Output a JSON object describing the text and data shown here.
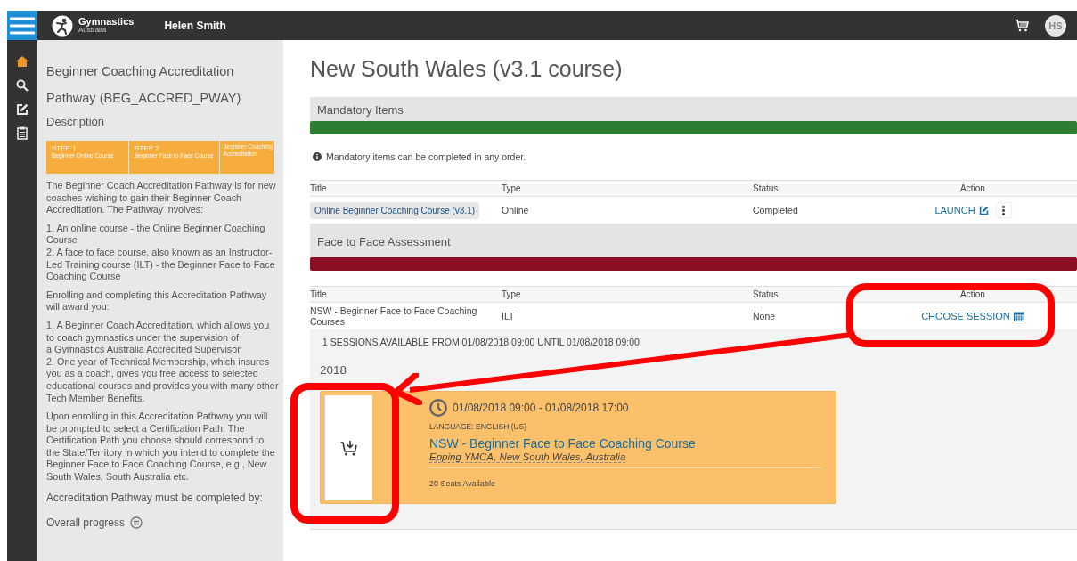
{
  "top_bar": {
    "org_name": "Gymnastics",
    "org_sub": "Australia",
    "user_name": "Helen Smith",
    "avatar_initials": "HS"
  },
  "nav": [
    {
      "kind": "home",
      "selected": true
    },
    {
      "kind": "search",
      "selected": false
    },
    {
      "kind": "edit",
      "selected": false
    },
    {
      "kind": "clipboard",
      "selected": false
    }
  ],
  "panel": {
    "title": "Beginner Coaching Accreditation Pathway (BEG_ACCRED_PWAY)",
    "description_label": "Description",
    "steps": [
      {
        "kind": "step",
        "title": "STEP 1",
        "subtitle": "Beginner Online Course"
      },
      {
        "kind": "step",
        "title": "STEP 2",
        "subtitle": "Beginner Face to Face Course"
      },
      {
        "kind": "final",
        "label": "Beginner Coaching Accreditation"
      }
    ],
    "paragraphs": [
      "The Beginner Coach Accreditation Pathway is for new coaches wishing to gain their Beginner Coach Accreditation. The Pathway involves:",
      "1. An online course - the Online Beginner Coaching Course\n2. A face to face course, also known as an Instructor-Led Training course (ILT) - the Beginner Face to Face Coaching Course",
      "Enrolling and completing this Accreditation Pathway will award you:",
      "1. A Beginner Coach Accreditation, which allows you to coach gymnastics under the supervision of\na Gymnastics Australia Accredited Supervisor\n2. One year of Technical Membership, which insures you as a coach, gives you free access to selected educational courses and provides you with many other Tech Member Benefits.",
      "Upon enrolling in this Accreditation Pathway you will be prompted to select a Certification Path. The Certification Path you choose should correspond to the State/Territory in which you intend to complete the Beginner Face to Face Coaching Course, e.g., New South Wales, South Australia etc."
    ],
    "deadline_label": "Accreditation Pathway must be completed by:",
    "progress_label": "Overall progress"
  },
  "main": {
    "title": "New South Wales (v3.1 course)",
    "sections": [
      {
        "title": "Mandatory Items",
        "color": "#2e7d32",
        "info": "Mandatory items can be completed in any order.",
        "columns": [
          "Title",
          "Type",
          "Status",
          "Action"
        ],
        "rows": [
          {
            "title": "Online Beginner Coaching Course (v3.1)",
            "kind": "chip",
            "type": "Online",
            "status": "Completed",
            "action": {
              "kind": "launch",
              "label": "LAUNCH"
            }
          }
        ]
      },
      {
        "title": "Face to Face Assessment",
        "color": "#8a0e24",
        "columns": [
          "Title",
          "Type",
          "Status",
          "Action"
        ],
        "rows": [
          {
            "title": "NSW - Beginner Face to Face Coaching Courses",
            "kind": "plain",
            "type": "ILT",
            "status": "None",
            "action": {
              "kind": "choose",
              "label": "CHOOSE SESSION"
            }
          }
        ],
        "sessions": {
          "summary": "1 SESSIONS AVAILABLE FROM 01/08/2018 09:00 UNTIL 01/08/2018 09:00",
          "year": "2018",
          "cards": [
            {
              "time": "01/08/2018 09:00 - 01/08/2018 17:00",
              "language": "LANGUAGE: ENGLISH (US)",
              "title": "NSW - Beginner Face to Face Coaching Course",
              "location": "Epping YMCA, New South Wales, Australia",
              "seats": "20 Seats Available"
            }
          ]
        }
      }
    ]
  }
}
